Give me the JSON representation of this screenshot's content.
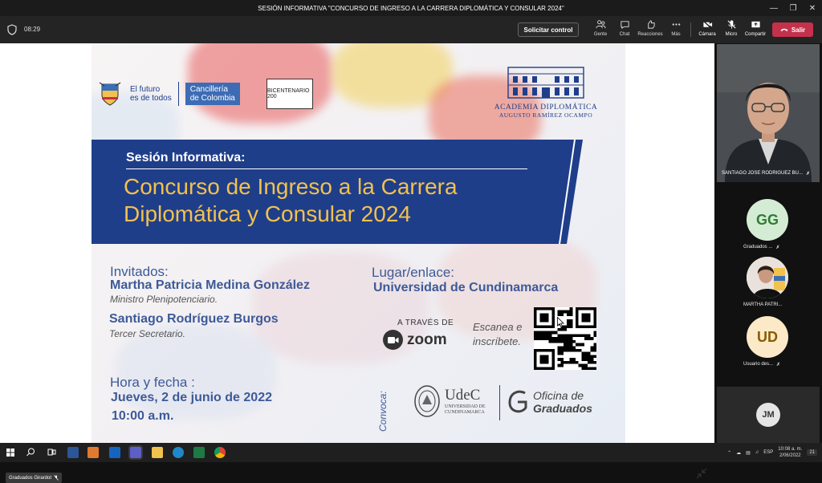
{
  "window": {
    "title": "SESIÓN INFORMATIVA \"CONCURSO DE INGRESO A LA CARRERA DIPLOMÁTICA Y CONSULAR 2024\""
  },
  "toolbar": {
    "timer": "08:29",
    "request_control": "Solicitar control",
    "people": "Gente",
    "chat": "Chat",
    "reactions": "Reacciones",
    "more": "Más",
    "camera": "Cámara",
    "mic": "Micro",
    "share": "Compartir",
    "leave": "Salir"
  },
  "slide": {
    "gov_line1": "El futuro",
    "gov_line2": "es de todos",
    "cancilleria_1": "Cancillería",
    "cancilleria_2": "de Colombia",
    "bicentenario": "BICENTENARIO 200",
    "academy_1": "ACADEMIA DIPLOMÁTICA",
    "academy_2": "AUGUSTO RAMÍREZ OCAMPO",
    "subtitle": "Sesión Informativa:",
    "title_1": "Concurso de Ingreso a la Carrera",
    "title_2": "Diplomática y Consular 2024",
    "guests_heading": "Invitados:",
    "guest1_name": "Martha Patricia Medina González",
    "guest1_role": "Ministro Plenipotenciario.",
    "guest2_name": "Santiago Rodríguez Burgos",
    "guest2_role": "Tercer Secretario.",
    "place_heading": "Lugar/enlace:",
    "place_value": "Universidad de Cundinamarca",
    "via": "A TRAVÉS DE",
    "zoom": "zoom",
    "scan_1": "Escanea e",
    "scan_2": "inscríbete.",
    "date_heading": "Hora y fecha :",
    "date_value": "Jueves, 2 de junio de 2022",
    "time_value": "10:00 a.m.",
    "convoca": "Convoca:",
    "udec_1": "UdeC",
    "udec_2": "UNIVERSIDAD DE",
    "udec_3": "CUNDINAMARCA",
    "grad_1": "Oficina de",
    "grad_2": "Graduados"
  },
  "presenter_tag": "Graduados Girardot",
  "participants": {
    "video_name": "SANTIAGO JOSE RODRIGUEZ BU...",
    "p1_initials": "GG",
    "p1_label": "Graduados ...",
    "p2_label": "MARTHA PATRI...",
    "p3_initials": "UD",
    "p3_label": "Usuario des...",
    "p4_initials": "JM"
  },
  "taskbar": {
    "lang": "ESP",
    "time": "10:08 a. m.",
    "date": "2/06/2022",
    "notif": "21"
  },
  "colors": {
    "banner_blue": "#1f3e8a",
    "title_gold": "#f2c14e",
    "text_blue": "#3d5a98",
    "leave_red": "#c4314b",
    "gg_bg": "#d5ecd4",
    "gg_fg": "#2e7d32",
    "ud_bg": "#fbe9c8",
    "ud_fg": "#8a5a00"
  }
}
